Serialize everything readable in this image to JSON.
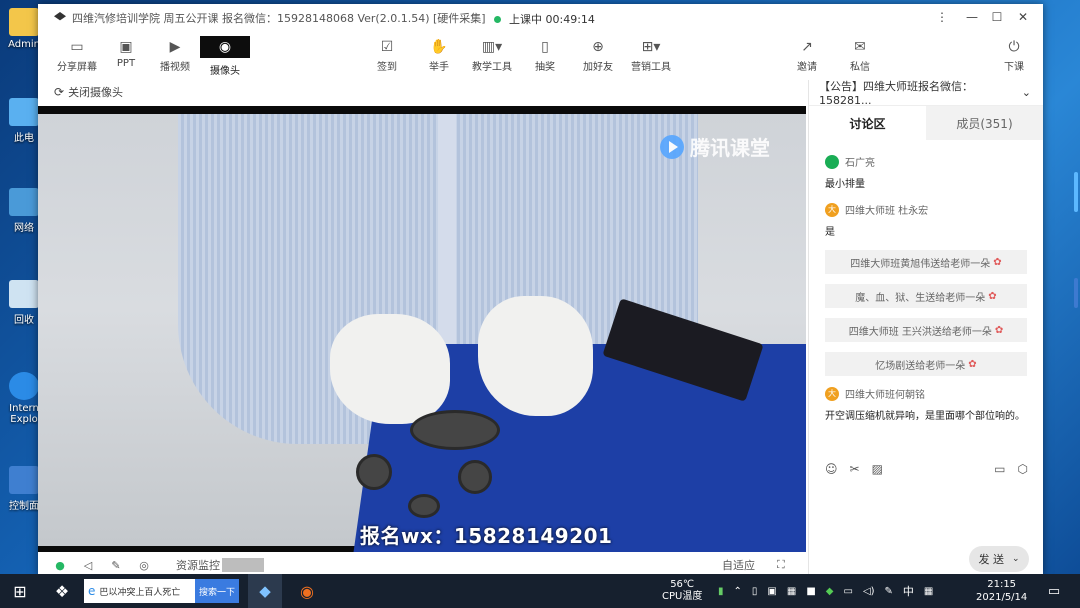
{
  "desktop": {
    "icons": [
      {
        "label": "Admin"
      },
      {
        "label": "此电"
      },
      {
        "label": "网络"
      },
      {
        "label": "回收"
      },
      {
        "label": "Intern Explo"
      },
      {
        "label": "控制面"
      }
    ]
  },
  "window": {
    "title": "四维汽修培训学院  周五公开课  报名微信：15928148068 Ver(2.0.1.54) [硬件采集]",
    "status": "上课中 00:49:14",
    "controls": [
      "⋮",
      "—",
      "☐",
      "✕"
    ]
  },
  "toolbar": {
    "left": [
      {
        "label": "分享屏幕",
        "icon": "screen-share-icon",
        "glyph": "▭"
      },
      {
        "label": "PPT",
        "icon": "ppt-icon",
        "glyph": "▣"
      },
      {
        "label": "播视频",
        "icon": "video-icon",
        "glyph": "▶"
      },
      {
        "label": "摄像头",
        "icon": "camera-icon",
        "glyph": "◉"
      }
    ],
    "center": [
      {
        "label": "签到",
        "icon": "checkin-icon",
        "glyph": "☑"
      },
      {
        "label": "举手",
        "icon": "hand-icon",
        "glyph": "✋"
      },
      {
        "label": "教学工具",
        "icon": "teaching-tools-icon",
        "glyph": "▥▾"
      },
      {
        "label": "抽奖",
        "icon": "lottery-icon",
        "glyph": "▯"
      },
      {
        "label": "加好友",
        "icon": "add-friend-icon",
        "glyph": "⊕"
      },
      {
        "label": "营销工具",
        "icon": "marketing-tools-icon",
        "glyph": "⊞▾"
      }
    ],
    "right": [
      {
        "label": "邀请",
        "icon": "invite-icon",
        "glyph": "↗"
      },
      {
        "label": "私信",
        "icon": "message-icon",
        "glyph": "✉"
      },
      {
        "label": "下课",
        "icon": "end-class-icon",
        "glyph": "⏻"
      }
    ]
  },
  "subbar": {
    "close_camera": "关闭摄像头"
  },
  "video": {
    "watermark": "腾讯课堂",
    "caption": "报名wx：15828149201"
  },
  "bottombar": {
    "monitor": "资源监控",
    "fit": "自适应"
  },
  "panel": {
    "notice": "【公告】四维大师班报名微信：  158281...",
    "tabs": [
      "讨论区",
      "成员(351)"
    ],
    "messages": [
      {
        "name": "石广亮",
        "avatar_color": "#1aad55",
        "text": "最小排量"
      },
      {
        "name": "四维大师班 杜永宏",
        "avatar_color": "#f0a020",
        "avatar_text": "大",
        "text": "是"
      }
    ],
    "gifts": [
      "四维大师班黄旭伟送给老师一朵",
      "魔、血、狱、生送给老师一朵",
      "四维大师班 王兴洪送给老师一朵",
      "忆场剧送给老师一朵"
    ],
    "last_message": {
      "name": "四维大师班何朝铭",
      "avatar_text": "大",
      "text": "开空调压缩机就异响，是里面哪个部位响的。"
    },
    "send": "发 送"
  },
  "taskbar": {
    "search_text": "巴以冲突上百人死亡",
    "search_button": "搜索一下",
    "temp": "56℃",
    "temp_label": "CPU温度",
    "ime": "中",
    "time": "21:15",
    "date": "2021/5/14"
  }
}
